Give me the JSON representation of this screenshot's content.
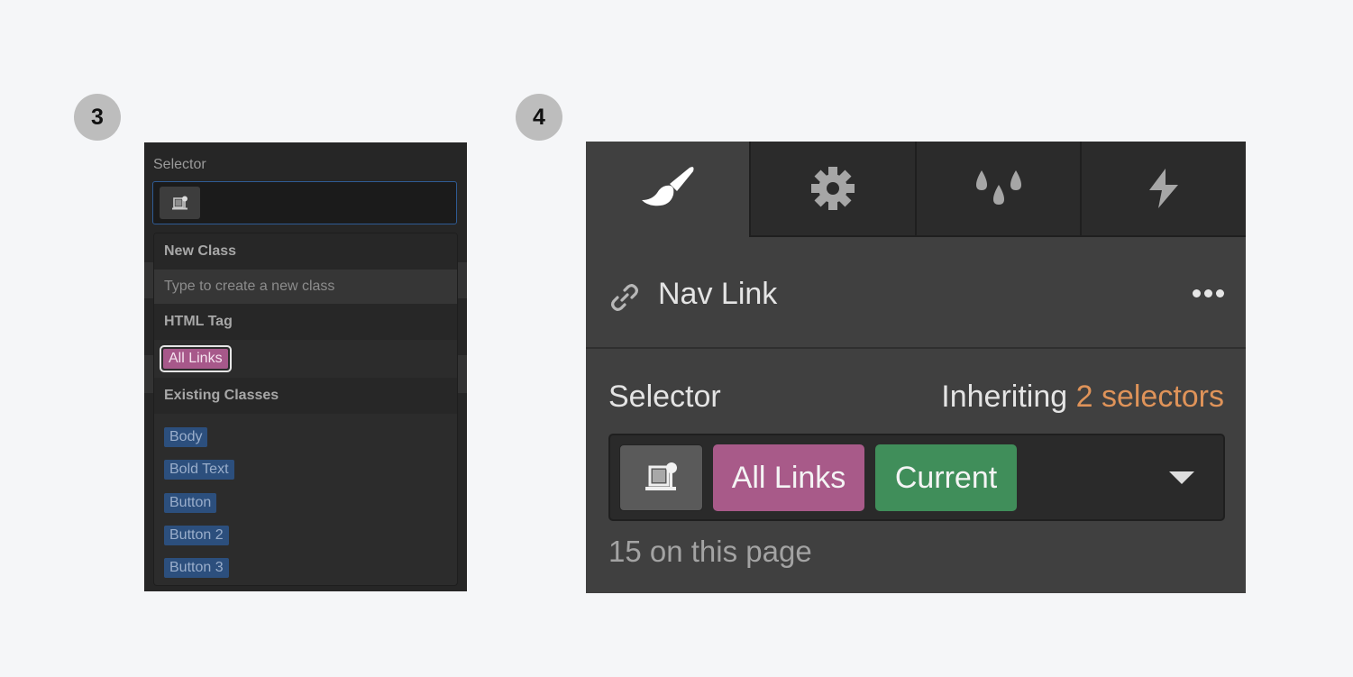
{
  "steps": [
    {
      "number": "3"
    },
    {
      "number": "4"
    }
  ],
  "panel_small": {
    "label": "Selector",
    "input_value": "",
    "tag_button_icon": "element-tag-icon",
    "dropdown": {
      "new_class_header": "New Class",
      "new_class_placeholder": "Type to create a new class",
      "html_tag_header": "HTML Tag",
      "html_tag_item": "All Links",
      "existing_classes_header": "Existing Classes",
      "existing_classes": [
        "Body",
        "Bold Text",
        "Button",
        "Button 2",
        "Button 3"
      ]
    }
  },
  "panel_large": {
    "tabs": [
      {
        "name": "style",
        "icon": "paintbrush-icon",
        "active": true
      },
      {
        "name": "settings",
        "icon": "gear-icon",
        "active": false
      },
      {
        "name": "style-manager",
        "icon": "droplets-icon",
        "active": false
      },
      {
        "name": "interactions",
        "icon": "lightning-icon",
        "active": false
      }
    ],
    "element": {
      "icon": "link-icon",
      "name": "Nav Link",
      "more_icon": "ellipsis-icon"
    },
    "selector_label": "Selector",
    "inheriting_prefix": "Inheriting",
    "inheriting_count": "2 selectors",
    "selector_tags": [
      {
        "label": "All Links",
        "kind": "html-tag",
        "color": "#a85a89"
      },
      {
        "label": "Current",
        "kind": "state",
        "color": "#408e5a"
      }
    ],
    "on_page_text": "15 on this page"
  },
  "colors": {
    "accent_orange": "#df9359",
    "tag_pink": "#a85a89",
    "tag_green": "#408e5a",
    "tag_blue": "#2c4f7d",
    "focus_blue": "#2f5b94"
  }
}
